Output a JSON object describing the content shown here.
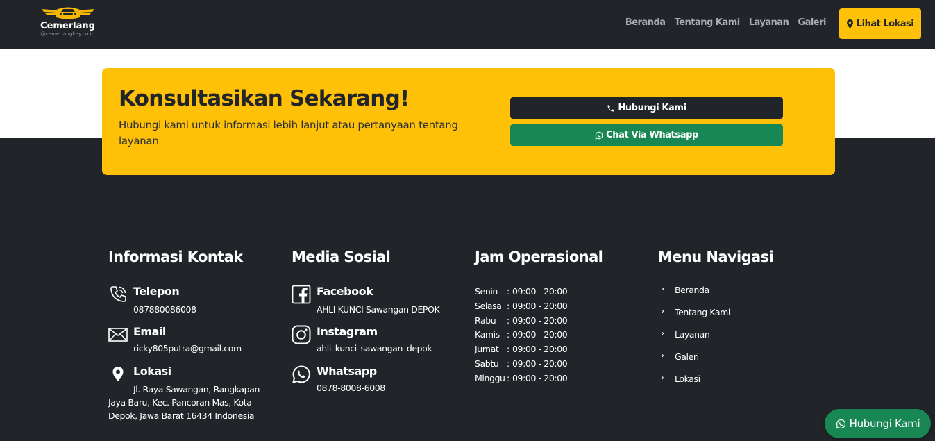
{
  "header": {
    "brand": "Cemerlang",
    "brand_sub": "@cemerlangkey.co.id",
    "nav": [
      "Beranda",
      "Tentang Kami",
      "Layanan",
      "Galeri"
    ],
    "cta_label": "Lihat Lokasi"
  },
  "hero": {
    "title": "Konsultasikan Sekarang!",
    "text": "Hubungi kami untuk informasi lebih lanjut atau pertanyaan tentang layanan",
    "call_label": "Hubungi Kami",
    "wa_label": "Chat Via Whatsapp"
  },
  "contact": {
    "heading": "Informasi Kontak",
    "phone_label": "Telepon",
    "phone": "087880086008",
    "email_label": "Email",
    "email": "ricky805putra@gmail.com",
    "location_label": "Lokasi",
    "address": "Jl. Raya Sawangan, Rangkapan Jaya Baru, Kec. Pancoran Mas, Kota Depok, Jawa Barat 16434 Indonesia"
  },
  "social": {
    "heading": "Media Sosial",
    "facebook_label": "Facebook",
    "facebook": "AHLI KUNCI Sawangan DEPOK",
    "instagram_label": "Instagram",
    "instagram": "ahli_kunci_sawangan_depok",
    "whatsapp_label": "Whatsapp",
    "whatsapp": "0878-8008-6008"
  },
  "hours": {
    "heading": "Jam Operasional",
    "rows": [
      {
        "day": "Senin",
        "time": "09:00 - 20:00"
      },
      {
        "day": "Selasa",
        "time": "09:00 - 20:00"
      },
      {
        "day": "Rabu",
        "time": "09:00 - 20:00"
      },
      {
        "day": "Kamis",
        "time": "09:00 - 20:00"
      },
      {
        "day": "Jumat",
        "time": "09:00 - 20:00"
      },
      {
        "day": "Sabtu",
        "time": "09:00 - 20:00"
      },
      {
        "day": "Minggu",
        "time": "09:00 - 20:00"
      }
    ]
  },
  "menu": {
    "heading": "Menu Navigasi",
    "items": [
      "Beranda",
      "Tentang Kami",
      "Layanan",
      "Galeri",
      "Lokasi"
    ]
  },
  "floating": {
    "label": "Hubungi Kami"
  },
  "colors": {
    "dark": "#212529",
    "accent": "#ffc107",
    "green": "#198754"
  }
}
